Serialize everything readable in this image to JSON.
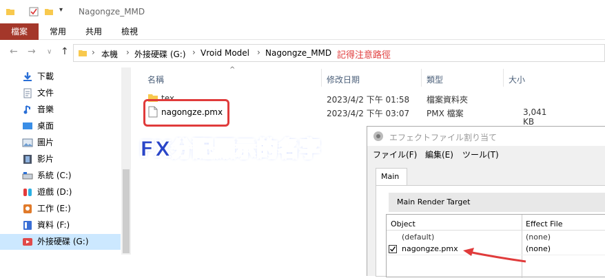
{
  "window": {
    "title": "Nagongze_MMD"
  },
  "ribbon": {
    "tabs": [
      "檔案",
      "常用",
      "共用",
      "檢視"
    ]
  },
  "breadcrumb": {
    "items": [
      "本機",
      "外接硬碟 (G:)",
      "Vroid Model",
      "Nagongze_MMD"
    ],
    "note": "記得注意路徑"
  },
  "sidebar": {
    "items": [
      {
        "label": "下載",
        "icon": "download-icon"
      },
      {
        "label": "文件",
        "icon": "document-icon"
      },
      {
        "label": "音樂",
        "icon": "music-icon"
      },
      {
        "label": "桌面",
        "icon": "desktop-icon"
      },
      {
        "label": "圖片",
        "icon": "pictures-icon"
      },
      {
        "label": "影片",
        "icon": "video-icon"
      },
      {
        "label": "系統 (C:)",
        "icon": "drive-icon"
      },
      {
        "label": "遊戲 (D:)",
        "icon": "game-drive-icon"
      },
      {
        "label": "工作 (E:)",
        "icon": "work-drive-icon"
      },
      {
        "label": "資料 (F:)",
        "icon": "data-drive-icon"
      },
      {
        "label": "外接硬碟 (G:)",
        "icon": "external-drive-icon"
      }
    ]
  },
  "columns": {
    "name": "名稱",
    "date": "修改日期",
    "type": "類型",
    "size": "大小"
  },
  "files": [
    {
      "name": "tex",
      "date": "2023/4/2 下午 01:58",
      "type": "檔案資料夾",
      "size": ""
    },
    {
      "name": "nagongze.pmx",
      "date": "2023/4/2 下午 03:07",
      "type": "PMX 檔案",
      "size": "3,041 KB"
    }
  ],
  "annotation": {
    "title": "FX分配顯示的名字",
    "accent": "#e03b3b"
  },
  "dialog": {
    "title": "エフェクトファイル割り当て",
    "menu": [
      "ファイル(F)",
      "編集(E)",
      "ツール(T)"
    ],
    "tab": "Main",
    "render_target": "Main Render Target",
    "headers": {
      "object": "Object",
      "effect": "Effect File"
    },
    "rows": [
      {
        "object": "(default)",
        "effect": "(none)"
      },
      {
        "object": "nagongze.pmx",
        "effect": "(none)"
      }
    ]
  }
}
